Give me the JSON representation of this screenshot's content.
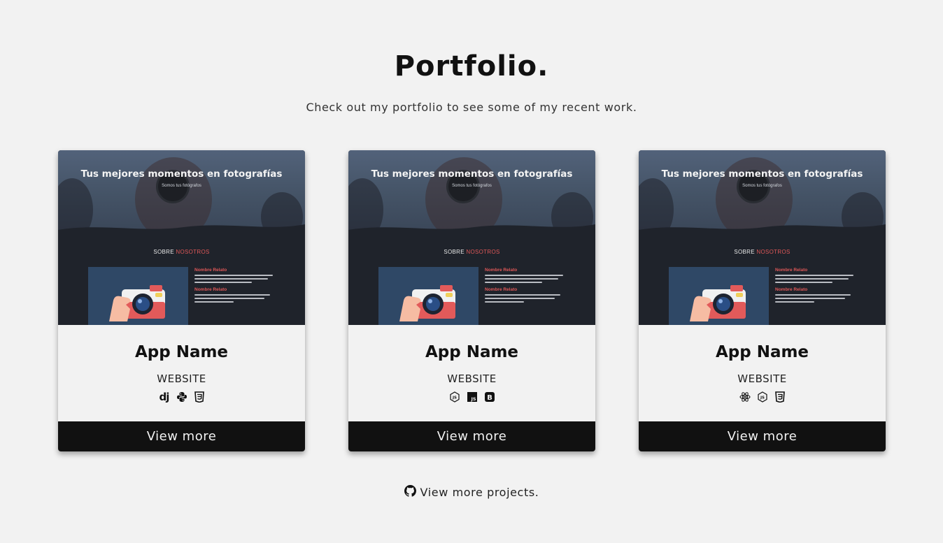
{
  "header": {
    "title": "Portfolio.",
    "subtitle": "Check out my portfolio to see some of my recent work."
  },
  "preview": {
    "hero_title": "Tus mejores momentos en fotografías",
    "hero_subtitle": "Somos tus fotógrafos",
    "about_prefix": "SOBRE",
    "about_accent": "NOSOTROS",
    "item_heading_1": "Nombre Relato",
    "item_heading_2": "Nombre Relato"
  },
  "cards": [
    {
      "name": "App Name",
      "type": "WEBSITE",
      "tech": [
        "django-icon",
        "python-icon",
        "css3-icon"
      ],
      "button": "View more"
    },
    {
      "name": "App Name",
      "type": "WEBSITE",
      "tech": [
        "nodejs-icon",
        "javascript-icon",
        "bootstrap-icon"
      ],
      "button": "View more"
    },
    {
      "name": "App Name",
      "type": "WEBSITE",
      "tech": [
        "react-icon",
        "nodejs-icon",
        "css3-icon"
      ],
      "button": "View more"
    }
  ],
  "footer": {
    "icon": "github-icon",
    "link": "View more projects."
  },
  "colors": {
    "background": "#f2f2f2",
    "button": "#111111",
    "accent": "#e05858"
  }
}
